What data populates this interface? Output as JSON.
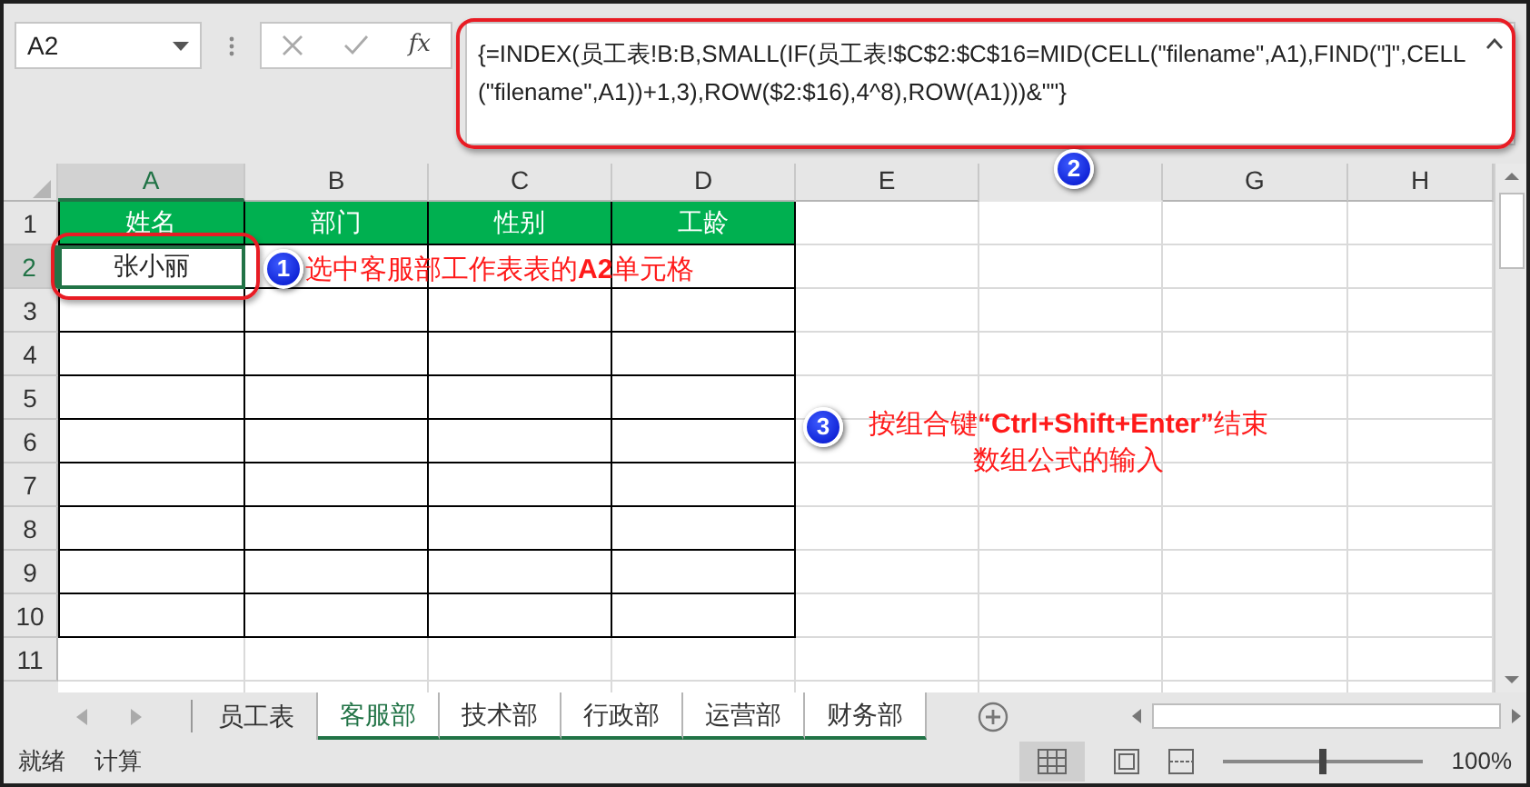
{
  "name_box": {
    "value": "A2"
  },
  "formula_bar": {
    "function_label": "fx",
    "formula": "{=INDEX(员工表!B:B,SMALL(IF(员工表!$C$2:$C$16=MID(CELL(\"filename\",A1),FIND(\"]\",CELL(\"filename\",A1))+1,3),ROW($2:$16),4^8),ROW(A1)))&\"\"}"
  },
  "columns": [
    {
      "label": "A",
      "selected": true
    },
    {
      "label": "B",
      "selected": false
    },
    {
      "label": "C",
      "selected": false
    },
    {
      "label": "D",
      "selected": false
    },
    {
      "label": "E",
      "selected": false
    },
    {
      "kind": "covered"
    },
    {
      "label": "G",
      "selected": false
    },
    {
      "label": "H",
      "selected": false
    }
  ],
  "rows": [
    {
      "header": "1",
      "selected": false,
      "kind": "header",
      "cells": [
        {
          "text": "姓名",
          "selected": false
        },
        {
          "text": "部门",
          "selected": false
        },
        {
          "text": "性别",
          "selected": false
        },
        {
          "text": "工龄",
          "selected": false
        }
      ]
    },
    {
      "header": "2",
      "selected": true,
      "kind": "data",
      "cells": [
        {
          "text": "张小丽",
          "selected": true
        }
      ]
    },
    {
      "header": "3",
      "selected": false,
      "kind": "data"
    },
    {
      "header": "4",
      "selected": false,
      "kind": "data"
    },
    {
      "header": "5",
      "selected": false,
      "kind": "data"
    },
    {
      "header": "6",
      "selected": false,
      "kind": "data"
    },
    {
      "header": "7",
      "selected": false,
      "kind": "data"
    },
    {
      "header": "8",
      "selected": false,
      "kind": "data"
    },
    {
      "header": "9",
      "selected": false,
      "kind": "data"
    },
    {
      "header": "10",
      "selected": false,
      "kind": "data"
    },
    {
      "header": "11",
      "selected": false,
      "kind": "plain"
    }
  ],
  "callouts": [
    {
      "number": "1",
      "text": "选中客服部工作表表的**A2**单元格"
    },
    {
      "number": "2"
    },
    {
      "number": "3",
      "text": "按组合键**“Ctrl+Shift+Enter”**结束数组公式的输入"
    }
  ],
  "sheet_tabs": [
    {
      "label": "员工表",
      "selected": false,
      "active": false
    },
    {
      "label": "客服部",
      "selected": true,
      "active": true
    },
    {
      "label": "技术部",
      "selected": true,
      "active": false
    },
    {
      "label": "行政部",
      "selected": true,
      "active": false
    },
    {
      "label": "运营部",
      "selected": true,
      "active": false
    },
    {
      "label": "财务部",
      "selected": true,
      "active": false
    }
  ],
  "status_bar": {
    "items": [
      "就绪",
      "计算"
    ],
    "zoom": {
      "reading": "100%",
      "level": 0.5
    }
  }
}
